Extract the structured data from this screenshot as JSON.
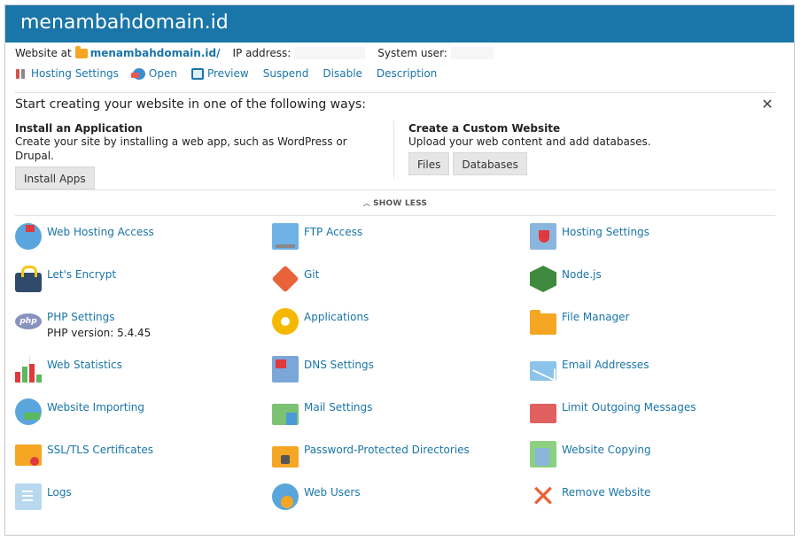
{
  "header": {
    "title": "menambahdomain.id"
  },
  "info": {
    "website_at_label": "Website at",
    "website_link": "menambahdomain.id/",
    "ip_label": "IP address:",
    "user_label": "System user:"
  },
  "actions": [
    {
      "label": "Hosting Settings",
      "icon": "tools-icon"
    },
    {
      "label": "Open",
      "icon": "globe-icon"
    },
    {
      "label": "Preview",
      "icon": "preview-icon"
    },
    {
      "label": "Suspend"
    },
    {
      "label": "Disable"
    },
    {
      "label": "Description"
    }
  ],
  "start": {
    "title": "Start creating your website in one of the following ways:",
    "close_icon": "close-icon",
    "app": {
      "title": "Install an Application",
      "desc": "Create your site by installing a web app, such as WordPress or Drupal.",
      "button": "Install Apps"
    },
    "custom": {
      "title": "Create a Custom Website",
      "desc": "Upload your web content and add databases.",
      "files_button": "Files",
      "db_button": "Databases"
    },
    "show_less": "SHOW LESS"
  },
  "tools": [
    {
      "label": "Web Hosting Access",
      "icon": "globe-flag-icon"
    },
    {
      "label": "FTP Access",
      "icon": "ftp-icon"
    },
    {
      "label": "Hosting Settings",
      "icon": "hosting-settings-icon"
    },
    {
      "label": "Let's Encrypt",
      "icon": "lock-icon"
    },
    {
      "label": "Git",
      "icon": "git-icon"
    },
    {
      "label": "Node.js",
      "icon": "nodejs-icon"
    },
    {
      "label": "PHP Settings",
      "icon": "php-icon",
      "sub": "PHP version: 5.4.45",
      "php_text": "php"
    },
    {
      "label": "Applications",
      "icon": "gear-icon"
    },
    {
      "label": "File Manager",
      "icon": "folder-icon"
    },
    {
      "label": "Web Statistics",
      "icon": "bar-chart-icon"
    },
    {
      "label": "DNS Settings",
      "icon": "dns-icon"
    },
    {
      "label": "Email Addresses",
      "icon": "envelope-icon"
    },
    {
      "label": "Website Importing",
      "icon": "globe-import-icon"
    },
    {
      "label": "Mail Settings",
      "icon": "mail-settings-icon"
    },
    {
      "label": "Limit Outgoing Messages",
      "icon": "envelope-limit-icon"
    },
    {
      "label": "SSL/TLS Certificates",
      "icon": "certificate-icon"
    },
    {
      "label": "Password-Protected Directories",
      "icon": "locked-folder-icon"
    },
    {
      "label": "Website Copying",
      "icon": "copy-icon"
    },
    {
      "label": "Logs",
      "icon": "log-file-icon"
    },
    {
      "label": "Web Users",
      "icon": "users-icon"
    },
    {
      "label": "Remove Website",
      "icon": "remove-icon",
      "remove_glyph": "✕"
    }
  ]
}
